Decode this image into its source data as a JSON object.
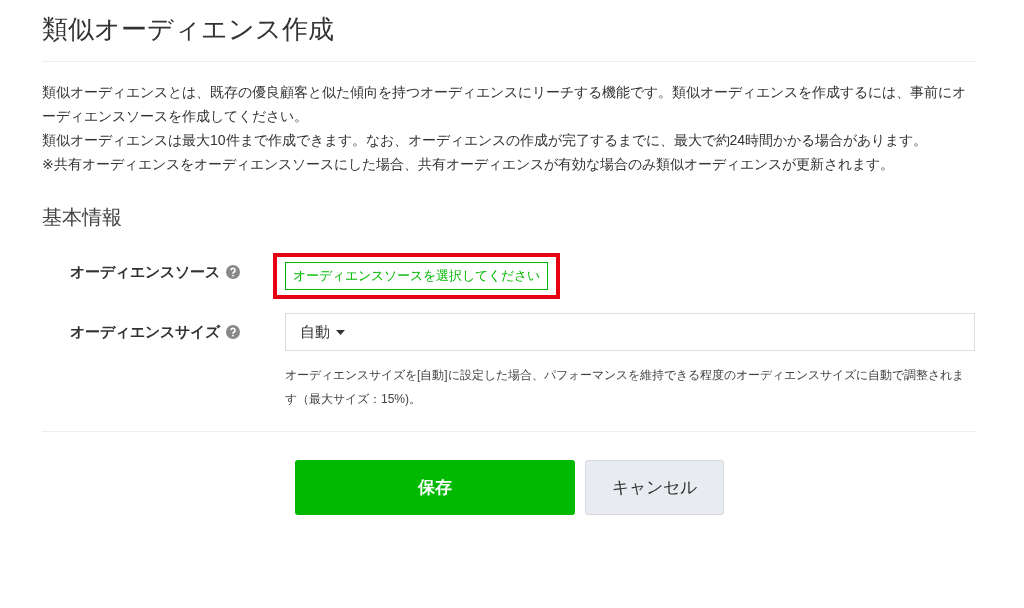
{
  "title": "類似オーディエンス作成",
  "description": [
    "類似オーディエンスとは、既存の優良顧客と似た傾向を持つオーディエンスにリーチする機能です。類似オーディエンスを作成するには、事前にオーディエンスソースを作成してください。",
    "類似オーディエンスは最大10件まで作成できます。なお、オーディエンスの作成が完了するまでに、最大で約24時間かかる場合があります。",
    "※共有オーディエンスをオーディエンスソースにした場合、共有オーディエンスが有効な場合のみ類似オーディエンスが更新されます。"
  ],
  "section_title": "基本情報",
  "fields": [
    {
      "kind": "source",
      "label": "オーディエンスソース",
      "button": "オーディエンスソースを選択してください",
      "highlighted": true
    },
    {
      "kind": "dropdown",
      "label": "オーディエンスサイズ",
      "value": "自動",
      "help": "オーディエンスサイズを[自動]に設定した場合、パフォーマンスを維持できる程度のオーディエンスサイズに自動で調整されます（最大サイズ：15%)。"
    }
  ],
  "buttons": {
    "save": "保存",
    "cancel": "キャンセル"
  }
}
